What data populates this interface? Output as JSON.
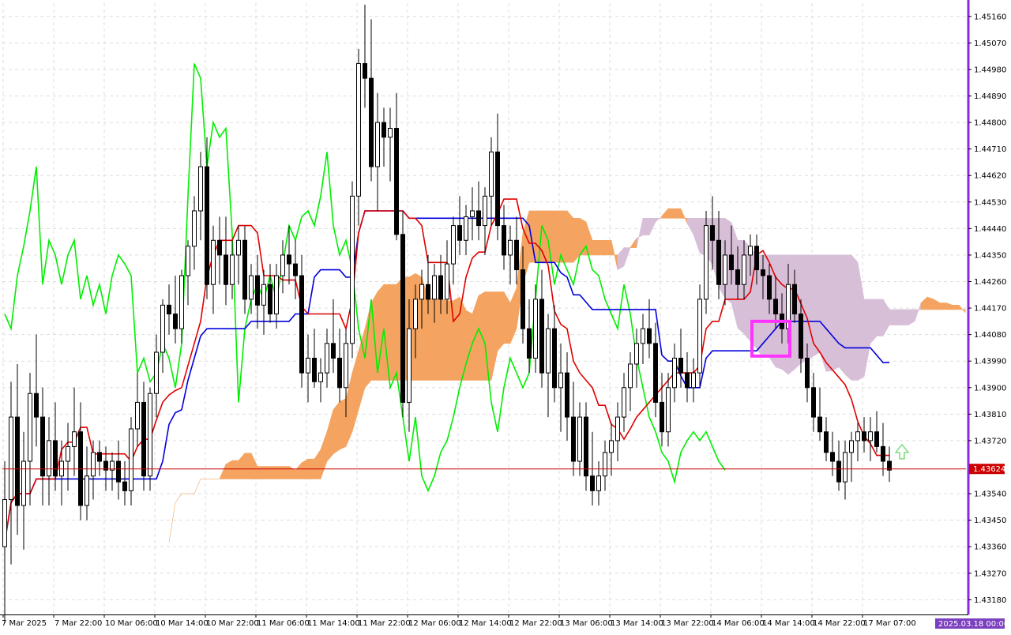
{
  "chart_data": {
    "type": "candlestick",
    "indicator": "Ichimoku Kinko Hyo",
    "price_axis": {
      "labels": [
        "1.45160",
        "1.45070",
        "1.44980",
        "1.44890",
        "1.44800",
        "1.44710",
        "1.44620",
        "1.44530",
        "1.44440",
        "1.44350",
        "1.44260",
        "1.44170",
        "1.44080",
        "1.43990",
        "1.43900",
        "1.43810",
        "1.43720",
        "1.43540",
        "1.43450",
        "1.43360",
        "1.43270",
        "1.43180"
      ],
      "ylim": [
        1.4313,
        1.45205
      ]
    },
    "time_axis": {
      "labels": [
        "7 Mar 2025",
        "7 Mar 22:00",
        "10 Mar 06:00",
        "10 Mar 14:00",
        "10 Mar 22:00",
        "11 Mar 06:00",
        "11 Mar 14:00",
        "11 Mar 22:00",
        "12 Mar 06:00",
        "12 Mar 14:00",
        "12 Mar 22:00",
        "13 Mar 06:00",
        "13 Mar 14:00",
        "13 Mar 22:00",
        "14 Mar 06:00",
        "14 Mar 14:00",
        "14 Mar 22:00",
        "17 Mar 07:00"
      ]
    },
    "current_price": "1.43624",
    "date_badge": "2025.03.18 00:00",
    "grid": true,
    "colors": {
      "tenkan": "#e00000",
      "kijun": "#0000dd",
      "chikou": "#00ee00",
      "cloud_bull": "#f4a460",
      "cloud_bear": "#d8bfd8",
      "highlight": "#ff33ff",
      "signal_arrow": "#7fd97f",
      "price_line": "#cc0000",
      "axis_border": "#8a2be2",
      "badge": "#7b3fbf"
    },
    "candles": [
      [
        1.4336,
        1.4365,
        1.431,
        1.4352
      ],
      [
        1.4352,
        1.4392,
        1.433,
        1.438
      ],
      [
        1.438,
        1.4398,
        1.434,
        1.435
      ],
      [
        1.435,
        1.4375,
        1.4335,
        1.4365
      ],
      [
        1.4365,
        1.4395,
        1.435,
        1.4388
      ],
      [
        1.4388,
        1.4408,
        1.437,
        1.438
      ],
      [
        1.438,
        1.439,
        1.435,
        1.436
      ],
      [
        1.436,
        1.438,
        1.435,
        1.4372
      ],
      [
        1.4372,
        1.4385,
        1.4355,
        1.436
      ],
      [
        1.436,
        1.4372,
        1.435,
        1.4365
      ],
      [
        1.4365,
        1.4378,
        1.4355,
        1.437
      ],
      [
        1.437,
        1.439,
        1.436,
        1.4375
      ],
      [
        1.4375,
        1.4385,
        1.4345,
        1.435
      ],
      [
        1.435,
        1.437,
        1.4345,
        1.436
      ],
      [
        1.436,
        1.4372,
        1.4352,
        1.4368
      ],
      [
        1.4368,
        1.4372,
        1.436,
        1.4365
      ],
      [
        1.4365,
        1.437,
        1.4355,
        1.4362
      ],
      [
        1.4362,
        1.4368,
        1.4355,
        1.4365
      ],
      [
        1.4365,
        1.4372,
        1.4352,
        1.4358
      ],
      [
        1.4358,
        1.4365,
        1.435,
        1.4355
      ],
      [
        1.4355,
        1.438,
        1.435,
        1.4376
      ],
      [
        1.4376,
        1.4395,
        1.437,
        1.4385
      ],
      [
        1.4385,
        1.4392,
        1.4355,
        1.436
      ],
      [
        1.436,
        1.439,
        1.4355,
        1.4388
      ],
      [
        1.4388,
        1.4408,
        1.438,
        1.4402
      ],
      [
        1.4402,
        1.442,
        1.4395,
        1.4418
      ],
      [
        1.4418,
        1.4425,
        1.4408,
        1.4415
      ],
      [
        1.4415,
        1.4428,
        1.4405,
        1.441
      ],
      [
        1.441,
        1.443,
        1.4405,
        1.4428
      ],
      [
        1.4428,
        1.444,
        1.4418,
        1.4438
      ],
      [
        1.4438,
        1.4455,
        1.443,
        1.445
      ],
      [
        1.445,
        1.447,
        1.444,
        1.4465
      ],
      [
        1.4465,
        1.4475,
        1.442,
        1.4425
      ],
      [
        1.4425,
        1.4445,
        1.4415,
        1.444
      ],
      [
        1.444,
        1.4448,
        1.4425,
        1.4435
      ],
      [
        1.4435,
        1.4448,
        1.4418,
        1.4425
      ],
      [
        1.4425,
        1.444,
        1.442,
        1.4435
      ],
      [
        1.4435,
        1.4445,
        1.4425,
        1.444
      ],
      [
        1.444,
        1.4445,
        1.4415,
        1.442
      ],
      [
        1.442,
        1.4432,
        1.4415,
        1.4428
      ],
      [
        1.4428,
        1.4435,
        1.441,
        1.4418
      ],
      [
        1.4418,
        1.443,
        1.4408,
        1.4425
      ],
      [
        1.4425,
        1.4432,
        1.4412,
        1.4415
      ],
      [
        1.4415,
        1.4432,
        1.441,
        1.4428
      ],
      [
        1.4428,
        1.444,
        1.4422,
        1.4435
      ],
      [
        1.4435,
        1.4445,
        1.4425,
        1.4432
      ],
      [
        1.4432,
        1.444,
        1.442,
        1.4428
      ],
      [
        1.4428,
        1.4435,
        1.439,
        1.4395
      ],
      [
        1.4395,
        1.4408,
        1.4385,
        1.44
      ],
      [
        1.44,
        1.441,
        1.439,
        1.4392
      ],
      [
        1.4392,
        1.44,
        1.4385,
        1.4395
      ],
      [
        1.4395,
        1.441,
        1.439,
        1.4405
      ],
      [
        1.4405,
        1.442,
        1.4395,
        1.44
      ],
      [
        1.44,
        1.441,
        1.4385,
        1.439
      ],
      [
        1.439,
        1.441,
        1.438,
        1.4405
      ],
      [
        1.4405,
        1.446,
        1.44,
        1.4455
      ],
      [
        1.4455,
        1.4505,
        1.4445,
        1.45
      ],
      [
        1.45,
        1.452,
        1.4485,
        1.4495
      ],
      [
        1.4495,
        1.4515,
        1.446,
        1.4465
      ],
      [
        1.4465,
        1.449,
        1.445,
        1.448
      ],
      [
        1.448,
        1.4485,
        1.4465,
        1.4475
      ],
      [
        1.4475,
        1.4485,
        1.446,
        1.4478
      ],
      [
        1.4478,
        1.449,
        1.444,
        1.4442
      ],
      [
        1.4442,
        1.445,
        1.438,
        1.4385
      ],
      [
        1.4385,
        1.442,
        1.4375,
        1.441
      ],
      [
        1.441,
        1.4425,
        1.44,
        1.442
      ],
      [
        1.442,
        1.443,
        1.441,
        1.4425
      ],
      [
        1.4425,
        1.4435,
        1.4415,
        1.442
      ],
      [
        1.442,
        1.4432,
        1.4412,
        1.4428
      ],
      [
        1.4428,
        1.4435,
        1.4415,
        1.442
      ],
      [
        1.442,
        1.444,
        1.4415,
        1.4432
      ],
      [
        1.4432,
        1.4448,
        1.4425,
        1.4445
      ],
      [
        1.4445,
        1.4455,
        1.4435,
        1.444
      ],
      [
        1.444,
        1.4452,
        1.4435,
        1.4448
      ],
      [
        1.4448,
        1.4458,
        1.444,
        1.445
      ],
      [
        1.445,
        1.446,
        1.444,
        1.4445
      ],
      [
        1.4445,
        1.4458,
        1.4435,
        1.4455
      ],
      [
        1.4455,
        1.4475,
        1.4445,
        1.447
      ],
      [
        1.447,
        1.4483,
        1.444,
        1.4445
      ],
      [
        1.4445,
        1.4452,
        1.443,
        1.4435
      ],
      [
        1.4435,
        1.4445,
        1.4425,
        1.444
      ],
      [
        1.444,
        1.4448,
        1.4425,
        1.443
      ],
      [
        1.443,
        1.4438,
        1.4405,
        1.441
      ],
      [
        1.441,
        1.442,
        1.4395,
        1.44
      ],
      [
        1.44,
        1.4425,
        1.4395,
        1.442
      ],
      [
        1.442,
        1.443,
        1.439,
        1.4395
      ],
      [
        1.4395,
        1.4415,
        1.438,
        1.441
      ],
      [
        1.441,
        1.4418,
        1.4385,
        1.439
      ],
      [
        1.439,
        1.4405,
        1.4375,
        1.4395
      ],
      [
        1.4395,
        1.4402,
        1.4372,
        1.438
      ],
      [
        1.438,
        1.4392,
        1.436,
        1.4365
      ],
      [
        1.4365,
        1.4385,
        1.436,
        1.438
      ],
      [
        1.438,
        1.4385,
        1.4355,
        1.436
      ],
      [
        1.436,
        1.4375,
        1.435,
        1.4355
      ],
      [
        1.4355,
        1.4365,
        1.435,
        1.436
      ],
      [
        1.436,
        1.4372,
        1.4355,
        1.4368
      ],
      [
        1.4368,
        1.4378,
        1.436,
        1.4372
      ],
      [
        1.4372,
        1.4385,
        1.4365,
        1.438
      ],
      [
        1.438,
        1.4395,
        1.4375,
        1.439
      ],
      [
        1.439,
        1.4402,
        1.4382,
        1.4398
      ],
      [
        1.4398,
        1.441,
        1.439,
        1.4405
      ],
      [
        1.4405,
        1.4415,
        1.4398,
        1.441
      ],
      [
        1.441,
        1.442,
        1.44,
        1.4405
      ],
      [
        1.4405,
        1.4412,
        1.438,
        1.4385
      ],
      [
        1.4385,
        1.4395,
        1.437,
        1.4375
      ],
      [
        1.4375,
        1.4395,
        1.437,
        1.439
      ],
      [
        1.439,
        1.4405,
        1.4385,
        1.44
      ],
      [
        1.44,
        1.441,
        1.439,
        1.4395
      ],
      [
        1.4395,
        1.4402,
        1.4385,
        1.439
      ],
      [
        1.439,
        1.44,
        1.4385,
        1.4395
      ],
      [
        1.4395,
        1.4425,
        1.439,
        1.442
      ],
      [
        1.442,
        1.445,
        1.4415,
        1.4445
      ],
      [
        1.4445,
        1.4455,
        1.443,
        1.444
      ],
      [
        1.444,
        1.445,
        1.442,
        1.4425
      ],
      [
        1.4425,
        1.444,
        1.4418,
        1.4435
      ],
      [
        1.4435,
        1.4445,
        1.4425,
        1.443
      ],
      [
        1.443,
        1.4438,
        1.442,
        1.4425
      ],
      [
        1.4425,
        1.444,
        1.442,
        1.4435
      ],
      [
        1.4435,
        1.4442,
        1.4428,
        1.4438
      ],
      [
        1.4438,
        1.4442,
        1.4425,
        1.443
      ],
      [
        1.443,
        1.4435,
        1.442,
        1.4428
      ],
      [
        1.4428,
        1.4432,
        1.4415,
        1.442
      ],
      [
        1.442,
        1.4428,
        1.441,
        1.4415
      ],
      [
        1.4415,
        1.4422,
        1.4405,
        1.441
      ],
      [
        1.441,
        1.4432,
        1.4405,
        1.4425
      ],
      [
        1.4425,
        1.443,
        1.4412,
        1.4415
      ],
      [
        1.4415,
        1.442,
        1.4395,
        1.44
      ],
      [
        1.44,
        1.4405,
        1.4385,
        1.439
      ],
      [
        1.439,
        1.4395,
        1.4375,
        1.438
      ],
      [
        1.438,
        1.439,
        1.4372,
        1.4375
      ],
      [
        1.4375,
        1.438,
        1.4365,
        1.4368
      ],
      [
        1.4368,
        1.4375,
        1.436,
        1.4365
      ],
      [
        1.4365,
        1.4372,
        1.4355,
        1.4358
      ],
      [
        1.4358,
        1.4372,
        1.4352,
        1.4368
      ],
      [
        1.4368,
        1.4375,
        1.4358,
        1.4372
      ],
      [
        1.4372,
        1.4378,
        1.4365,
        1.4375
      ],
      [
        1.4375,
        1.438,
        1.4368,
        1.4372
      ],
      [
        1.4372,
        1.438,
        1.4365,
        1.4375
      ],
      [
        1.4375,
        1.4382,
        1.4368,
        1.437
      ],
      [
        1.437,
        1.4378,
        1.436,
        1.4365
      ],
      [
        1.4365,
        1.437,
        1.4358,
        1.4362
      ]
    ]
  }
}
